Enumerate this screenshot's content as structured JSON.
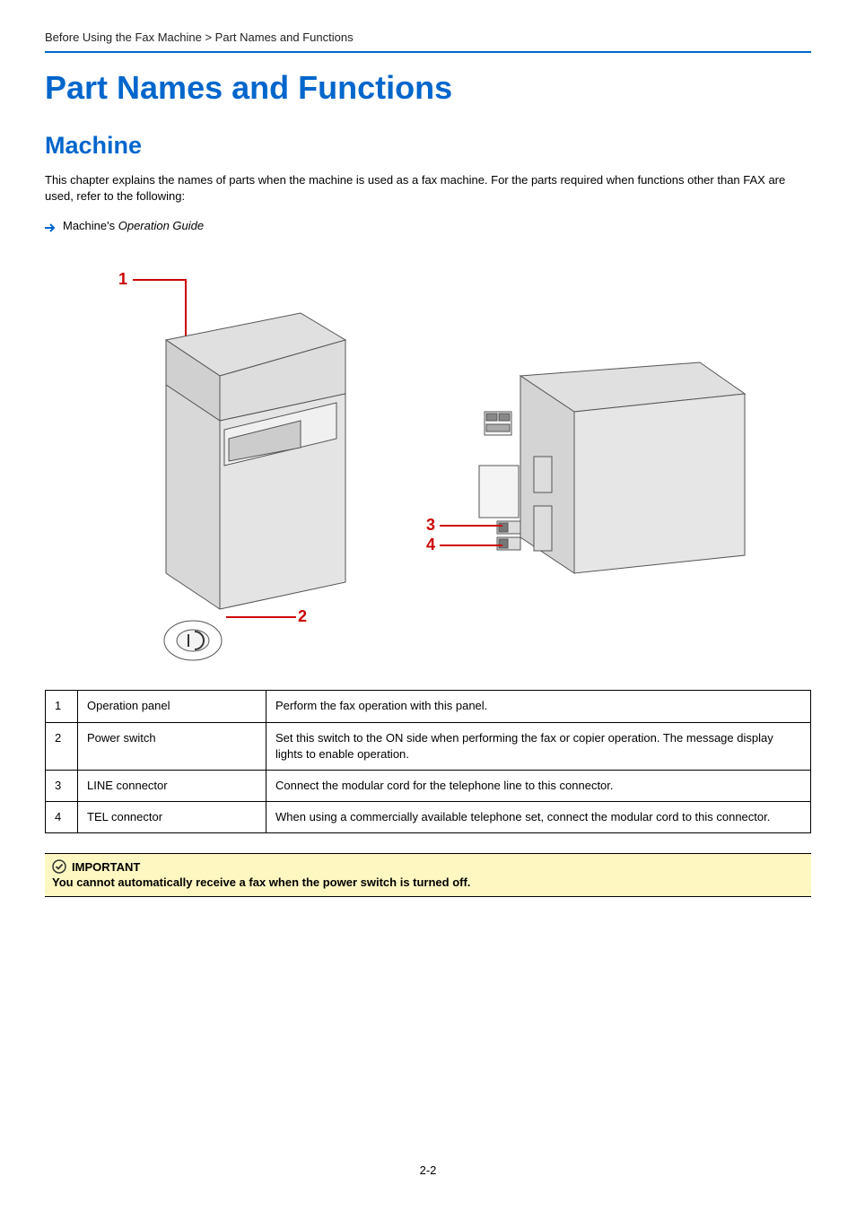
{
  "breadcrumb": "Before Using the Fax Machine > Part Names and Functions",
  "title": "Part Names and Functions",
  "subtitle": "Machine",
  "intro": "This chapter explains the names of parts when the machine is used as a fax machine. For the parts required when functions other than FAX are used, refer to the following:",
  "ref_prefix": "Machine's ",
  "ref_italic": "Operation Guide",
  "callouts": {
    "c1": "1",
    "c2": "2",
    "c3": "3",
    "c4": "4"
  },
  "parts_table": [
    {
      "num": "1",
      "name": "Operation panel",
      "desc": "Perform the fax operation with this panel."
    },
    {
      "num": "2",
      "name": "Power switch",
      "desc": "Set this switch to the ON side when performing the fax or copier operation. The message display lights to enable operation."
    },
    {
      "num": "3",
      "name": "LINE connector",
      "desc": "Connect the modular cord for the telephone line to this connector."
    },
    {
      "num": "4",
      "name": "TEL connector",
      "desc": "When using a commercially available telephone set, connect the modular cord to this connector."
    }
  ],
  "important_label": "IMPORTANT",
  "important_text": "You cannot automatically receive a fax when the power switch is turned off.",
  "page_number": "2-2"
}
